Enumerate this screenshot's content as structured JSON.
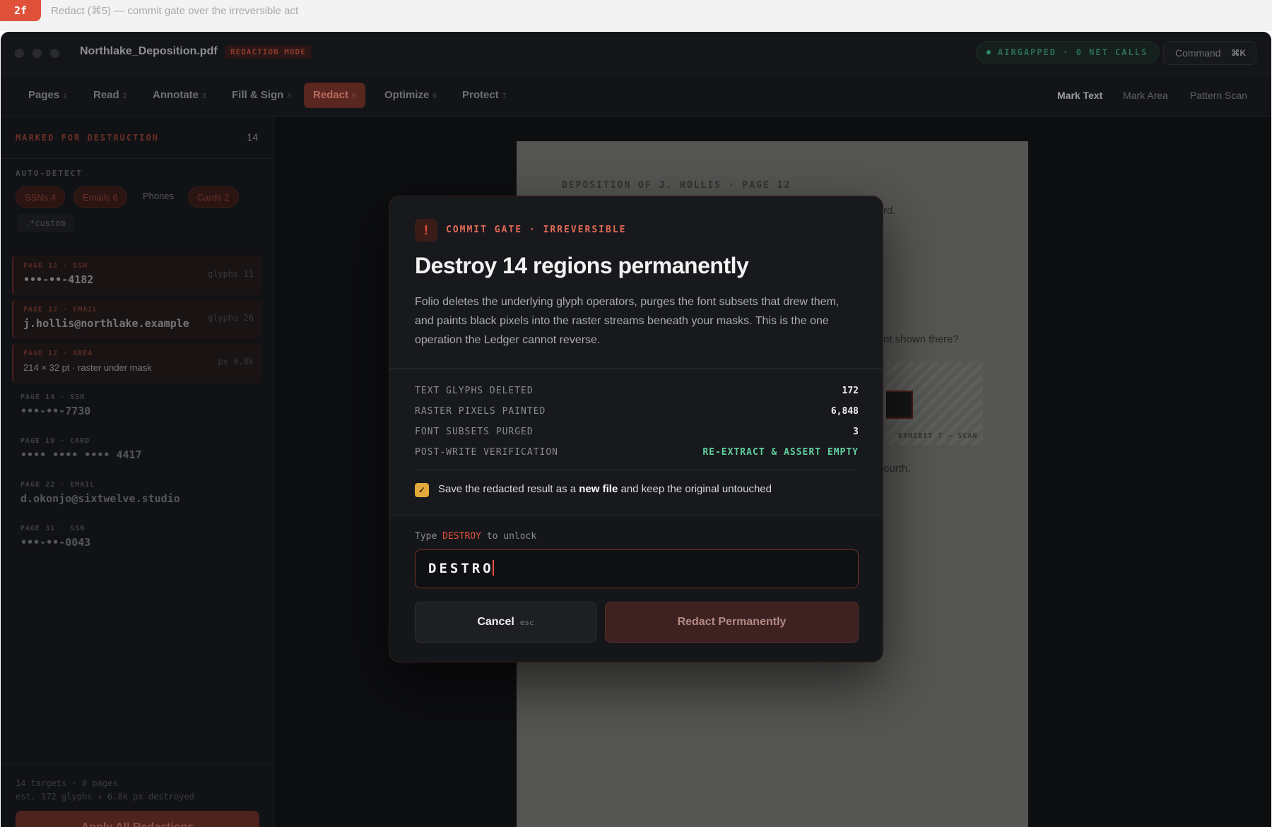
{
  "caption": {
    "tag": "2f",
    "text": "Redact (⌘5) — commit gate over the irreversible act"
  },
  "window": {
    "doc_title": "Northlake_Deposition.pdf",
    "mode_badge": "REDACTION MODE",
    "airgap": "AIRGAPPED · 0 NET CALLS",
    "command_label": "Command",
    "command_kbd": "⌘K"
  },
  "tabs": [
    {
      "label": "Pages",
      "num": "1"
    },
    {
      "label": "Read",
      "num": "2"
    },
    {
      "label": "Annotate",
      "num": "3"
    },
    {
      "label": "Fill & Sign",
      "num": "4"
    },
    {
      "label": "Redact",
      "num": "5"
    },
    {
      "label": "Optimize",
      "num": "6"
    },
    {
      "label": "Protect",
      "num": "7"
    }
  ],
  "tools": {
    "mark_text": "Mark Text",
    "mark_area": "Mark Area",
    "pattern_scan": "Pattern Scan"
  },
  "sidebar": {
    "heading": "MARKED FOR DESTRUCTION",
    "count": "14",
    "auto_detect": "AUTO-DETECT",
    "chips": {
      "ssns": "SSNs 4",
      "emails": "Emails 6",
      "phones": "Phones",
      "cards": "Cards 2",
      "custom": ".*custom"
    },
    "items": [
      {
        "meta": "PAGE 12 · SSN",
        "value": "•••-••-4182",
        "side": "glyphs 11"
      },
      {
        "meta": "PAGE 12 · EMAIL",
        "value": "j.hollis@northlake.example",
        "side": "glyphs 26"
      },
      {
        "meta": "PAGE 12 · AREA",
        "value": "214 × 32 pt · raster under mask",
        "side": "px 6.8k"
      },
      {
        "meta": "PAGE 14 · SSN",
        "value": "•••-••-7730"
      },
      {
        "meta": "PAGE 19 · CARD",
        "value": "•••• •••• •••• 4417"
      },
      {
        "meta": "PAGE 22 · EMAIL",
        "value": "d.okonjo@sixtwelve.studio"
      },
      {
        "meta": "PAGE 31 · SSN",
        "value": "•••-••-0043"
      }
    ],
    "footer_line1": "14 targets · 8 pages",
    "footer_line2": "est. 172 glyphs + 6.8k px destroyed",
    "apply_label": "Apply All Redactions"
  },
  "page": {
    "header": "DEPOSITION OF J. HOLLIS · PAGE 12",
    "frag1": "rd.",
    "frag2": "nt shown there?",
    "frag3": "ourth.",
    "exhibit_caption": "EXHIBIT 7 — SCAN"
  },
  "modal": {
    "icon": "!",
    "gate_label": "COMMIT GATE · IRREVERSIBLE",
    "title": "Destroy 14 regions permanently",
    "description": "Folio deletes the underlying glyph operators, purges the font subsets that drew them, and paints black pixels into the raster streams beneath your masks. This is the one operation the Ledger cannot reverse.",
    "stats": [
      {
        "key": "TEXT GLYPHS DELETED",
        "value": "172"
      },
      {
        "key": "RASTER PIXELS PAINTED",
        "value": "6,848"
      },
      {
        "key": "FONT SUBSETS PURGED",
        "value": "3"
      },
      {
        "key": "POST-WRITE VERIFICATION",
        "value": "RE-EXTRACT & ASSERT EMPTY"
      }
    ],
    "check_pre": "Save the redacted result as a ",
    "check_bold": "new file",
    "check_post": " and keep the original untouched",
    "type_pre": "Type ",
    "type_kw": "DESTROY",
    "type_post": " to unlock",
    "input_value": "DESTRO",
    "cancel_label": "Cancel",
    "cancel_key": "esc",
    "confirm_label": "Redact Permanently"
  }
}
